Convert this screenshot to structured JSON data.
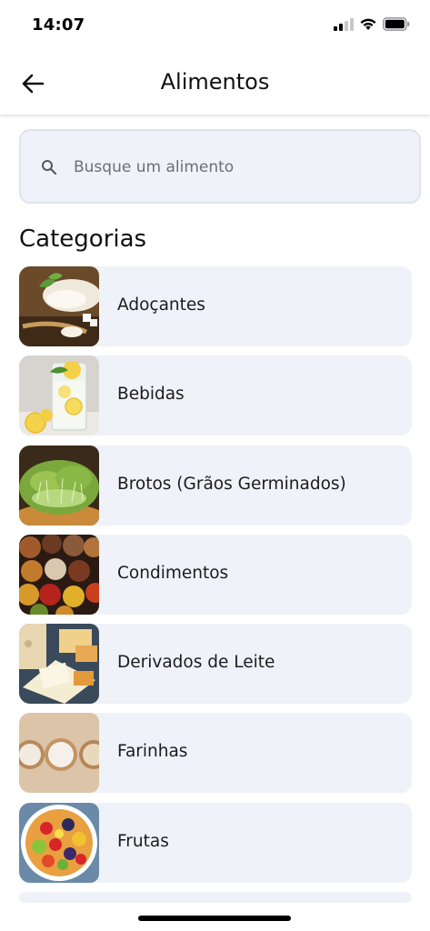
{
  "status": {
    "time": "14:07"
  },
  "header": {
    "title": "Alimentos",
    "back_icon": "arrow-left-icon"
  },
  "search": {
    "placeholder": "Busque um alimento",
    "value": "",
    "icon": "search-icon"
  },
  "section": {
    "title": "Categorias"
  },
  "categories": [
    {
      "label": "Adoçantes",
      "image": "sweeteners-photo"
    },
    {
      "label": "Bebidas",
      "image": "drinks-photo"
    },
    {
      "label": "Brotos (Grãos Germinados)",
      "image": "sprouts-photo"
    },
    {
      "label": "Condimentos",
      "image": "spices-photo"
    },
    {
      "label": "Derivados de Leite",
      "image": "dairy-photo"
    },
    {
      "label": "Farinhas",
      "image": "flours-photo"
    },
    {
      "label": "Frutas",
      "image": "fruits-photo"
    }
  ]
}
